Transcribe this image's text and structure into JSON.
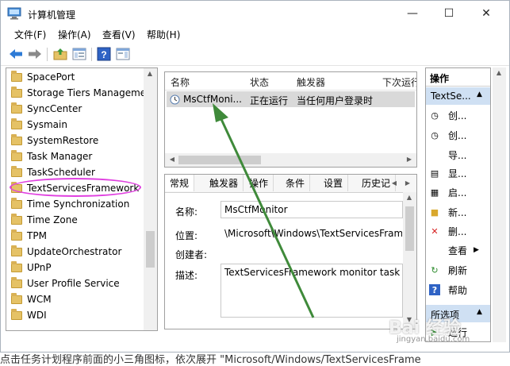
{
  "window": {
    "title": "计算机管理",
    "min_glyph": "—",
    "max_glyph": "☐",
    "close_glyph": "✕"
  },
  "menu": [
    "文件(F)",
    "操作(A)",
    "查看(V)",
    "帮助(H)"
  ],
  "tree": {
    "items": [
      "SpacePort",
      "Storage Tiers Managemen",
      "SyncCenter",
      "Sysmain",
      "SystemRestore",
      "Task Manager",
      "TaskScheduler",
      "TextServicesFramework",
      "Time Synchronization",
      "Time Zone",
      "TPM",
      "UpdateOrchestrator",
      "UPnP",
      "User Profile Service",
      "WCM",
      "WDI"
    ],
    "selected": "TextServicesFramework"
  },
  "task_list": {
    "columns": [
      "名称",
      "状态",
      "触发器",
      "下次运行"
    ],
    "rows": [
      {
        "name": "MsCtfMoni...",
        "status": "正在运行",
        "trigger": "当任何用户登录时"
      }
    ]
  },
  "details": {
    "tabs": [
      "常规",
      "触发器",
      "操作",
      "条件",
      "设置",
      "历史记"
    ],
    "active_tab": "常规",
    "fields": {
      "name_label": "名称:",
      "name_value": "MsCtfMonitor",
      "location_label": "位置:",
      "location_value": "\\Microsoft\\Windows\\TextServicesFrame",
      "author_label": "创建者:",
      "desc_label": "描述:",
      "desc_value": "TextServicesFramework monitor task"
    }
  },
  "actions": {
    "header": "操作",
    "section1": "TextSe...",
    "items": [
      "创...",
      "创...",
      "导...",
      "显...",
      "启...",
      "新...",
      "删...",
      "查看",
      "刷新",
      "帮助"
    ],
    "section2": "所选项",
    "items2": [
      "运行"
    ]
  },
  "overlay": {
    "watermark": "Bai  经验",
    "watermark_sub": "jingyan.baidu.com"
  },
  "caption": "点击任务计划程序前面的小三角图标，依次展开 \"Microsoft/Windows/TextServicesFrame"
}
